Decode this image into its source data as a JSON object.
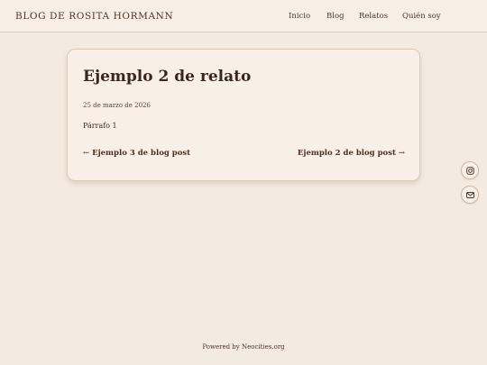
{
  "header": {
    "site_title": "BLOG DE ROSITA HORMANN",
    "nav": [
      "Inicio",
      "Blog",
      "Relatos",
      "Quién soy"
    ]
  },
  "post": {
    "title": "Ejemplo 2 de relato",
    "date": "25 de marzo de 2026",
    "body": "Párrafo 1",
    "prev_arrow": "←",
    "prev_label": "Ejemplo 3 de blog post",
    "next_label": "Ejemplo 2 de blog post",
    "next_arrow": "→"
  },
  "social": {
    "icons": [
      "instagram-icon",
      "mail-icon"
    ]
  },
  "footer": {
    "prefix": "Powered by ",
    "link": "Neocities.org"
  },
  "colors": {
    "background": "#f4ebe0",
    "card": "#f8efe6",
    "text": "#3d2a1f",
    "border": "#dccbb8"
  }
}
